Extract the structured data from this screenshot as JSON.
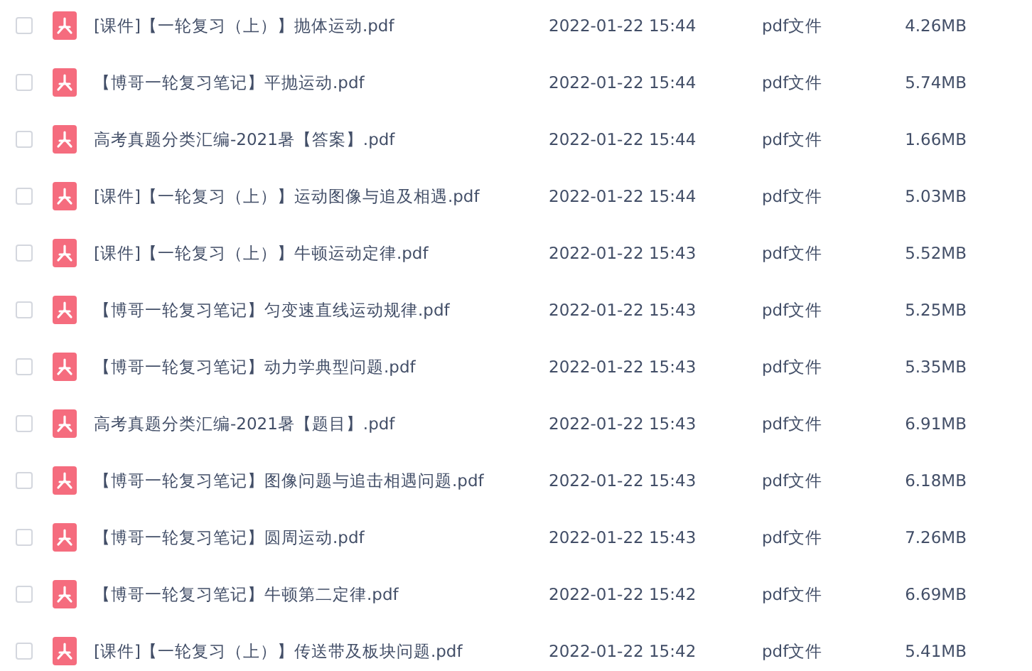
{
  "files": [
    {
      "name": "[课件]【一轮复习（上）】抛体运动.pdf",
      "checked": false,
      "date": "2022-01-22 15:44",
      "type": "pdf文件",
      "size": "4.26MB"
    },
    {
      "name": "【博哥一轮复习笔记】平抛运动.pdf",
      "checked": false,
      "date": "2022-01-22 15:44",
      "type": "pdf文件",
      "size": "5.74MB"
    },
    {
      "name": "高考真题分类汇编-2021暑【答案】.pdf",
      "checked": false,
      "date": "2022-01-22 15:44",
      "type": "pdf文件",
      "size": "1.66MB"
    },
    {
      "name": "[课件]【一轮复习（上）】运动图像与追及相遇.pdf",
      "checked": false,
      "date": "2022-01-22 15:44",
      "type": "pdf文件",
      "size": "5.03MB"
    },
    {
      "name": "[课件]【一轮复习（上）】牛顿运动定律.pdf",
      "checked": false,
      "date": "2022-01-22 15:43",
      "type": "pdf文件",
      "size": "5.52MB"
    },
    {
      "name": "【博哥一轮复习笔记】匀变速直线运动规律.pdf",
      "checked": false,
      "date": "2022-01-22 15:43",
      "type": "pdf文件",
      "size": "5.25MB"
    },
    {
      "name": "【博哥一轮复习笔记】动力学典型问题.pdf",
      "checked": false,
      "date": "2022-01-22 15:43",
      "type": "pdf文件",
      "size": "5.35MB"
    },
    {
      "name": "高考真题分类汇编-2021暑【题目】.pdf",
      "checked": false,
      "date": "2022-01-22 15:43",
      "type": "pdf文件",
      "size": "6.91MB"
    },
    {
      "name": "【博哥一轮复习笔记】图像问题与追击相遇问题.pdf",
      "checked": false,
      "date": "2022-01-22 15:43",
      "type": "pdf文件",
      "size": "6.18MB"
    },
    {
      "name": "【博哥一轮复习笔记】圆周运动.pdf",
      "checked": false,
      "date": "2022-01-22 15:43",
      "type": "pdf文件",
      "size": "7.26MB"
    },
    {
      "name": "【博哥一轮复习笔记】牛顿第二定律.pdf",
      "checked": false,
      "date": "2022-01-22 15:42",
      "type": "pdf文件",
      "size": "6.69MB"
    },
    {
      "name": "[课件]【一轮复习（上）】传送带及板块问题.pdf",
      "checked": false,
      "date": "2022-01-22 15:42",
      "type": "pdf文件",
      "size": "5.41MB"
    }
  ]
}
